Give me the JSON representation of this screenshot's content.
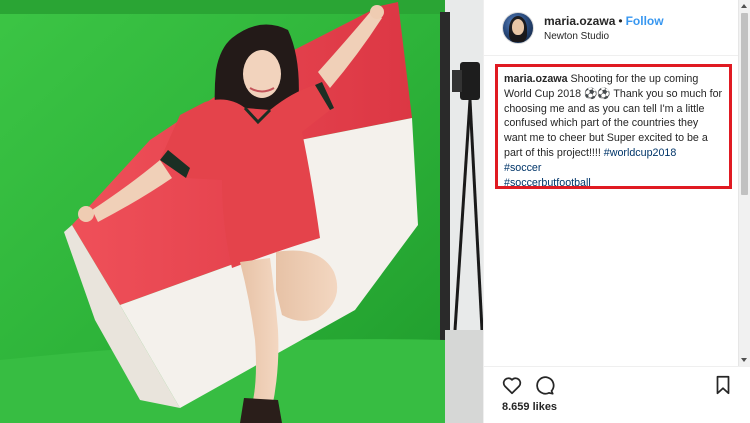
{
  "post": {
    "username": "maria.ozawa",
    "separator": "•",
    "follow_label": "Follow",
    "location": "Newton Studio"
  },
  "caption": {
    "username": "maria.ozawa",
    "text": " Shooting for the up coming World Cup 2018 ⚽⚽ Thank you so much for choosing me and as you can tell I'm a little confused which part of the countries they want me to cheer but Super excited to be a part of this project!!!! ",
    "hashtags": [
      "#worldcup2018",
      "#soccer",
      "#soccerbutfootball"
    ]
  },
  "engagement": {
    "likes": "8.659 likes"
  },
  "icons": {
    "like": "heart-icon",
    "comment": "comment-icon",
    "save": "bookmark-icon"
  },
  "colors": {
    "follow_blue": "#3897f0",
    "hashtag_blue": "#003569",
    "highlight_red": "#e01a22",
    "green_screen": "#2fb53a",
    "flag_red": "#e8424e",
    "flag_white": "#f4f1ec"
  }
}
